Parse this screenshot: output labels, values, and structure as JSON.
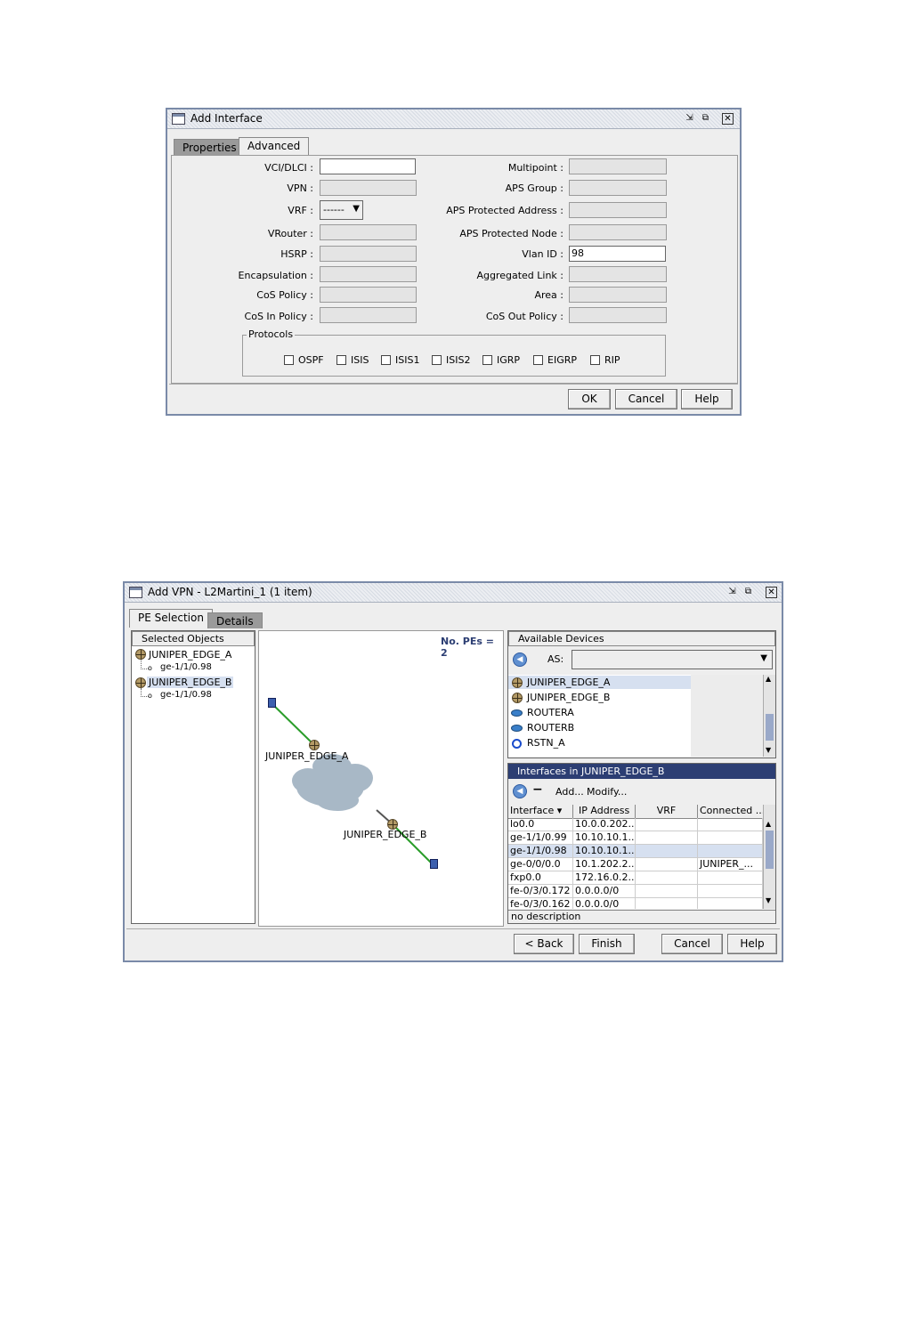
{
  "add_interface": {
    "title": "Add Interface",
    "tabs": [
      "Properties",
      "Advanced"
    ],
    "left_fields": [
      {
        "label": "VCI/DLCI :",
        "value": "",
        "editable": true
      },
      {
        "label": "VPN :",
        "value": ""
      },
      {
        "label": "VRF :",
        "value": "------",
        "dropdown": true
      },
      {
        "label": "VRouter :",
        "value": ""
      },
      {
        "label": "HSRP :",
        "value": ""
      },
      {
        "label": "Encapsulation :",
        "value": ""
      },
      {
        "label": "CoS Policy :",
        "value": ""
      },
      {
        "label": "CoS In Policy :",
        "value": ""
      }
    ],
    "right_fields": [
      {
        "label": "Multipoint :",
        "value": ""
      },
      {
        "label": "APS Group :",
        "value": ""
      },
      {
        "label": "APS Protected Address :",
        "value": ""
      },
      {
        "label": "APS Protected Node :",
        "value": ""
      },
      {
        "label": "Vlan ID :",
        "value": "98",
        "editable": true
      },
      {
        "label": "Aggregated Link :",
        "value": ""
      },
      {
        "label": "Area :",
        "value": ""
      },
      {
        "label": "CoS Out Policy :",
        "value": ""
      }
    ],
    "protocols_legend": "Protocols",
    "protocols": [
      "OSPF",
      "ISIS",
      "ISIS1",
      "ISIS2",
      "IGRP",
      "EIGRP",
      "RIP"
    ],
    "buttons": {
      "ok": "OK",
      "cancel": "Cancel",
      "help": "Help"
    }
  },
  "add_vpn": {
    "title": "Add VPN - L2Martini_1 (1 item)",
    "tabs": [
      "PE Selection",
      "Details"
    ],
    "selected_header": "Selected Objects",
    "tree": [
      {
        "label": "JUNIPER_EDGE_A",
        "child": "ge-1/1/0.98"
      },
      {
        "label": "JUNIPER_EDGE_B",
        "child": "ge-1/1/0.98"
      }
    ],
    "pe_count": "No. PEs = 2",
    "topology_labels": {
      "a": "JUNIPER_EDGE_A",
      "b": "JUNIPER_EDGE_B"
    },
    "available_header": "Available Devices",
    "as_label": "AS:",
    "devices": [
      {
        "name": "JUNIPER_EDGE_A",
        "icon": "juniper-router-icon"
      },
      {
        "name": "JUNIPER_EDGE_B",
        "icon": "juniper-router-icon"
      },
      {
        "name": "ROUTERA",
        "icon": "router-icon"
      },
      {
        "name": "ROUTERB",
        "icon": "router-icon"
      },
      {
        "name": "RSTN_A",
        "icon": "rstn-icon"
      }
    ],
    "interfaces_header": "Interfaces in JUNIPER_EDGE_B",
    "iface_actions": {
      "remove": "−",
      "add": "Add...",
      "modify": "Modify..."
    },
    "columns": [
      "Interface ▾",
      "IP Address",
      "VRF",
      "Connected ..."
    ],
    "rows": [
      [
        "lo0.0",
        "10.0.0.202...",
        "",
        ""
      ],
      [
        "ge-1/1/0.99",
        "10.10.10.1...",
        "",
        ""
      ],
      [
        "ge-1/1/0.98",
        "10.10.10.1...",
        "",
        ""
      ],
      [
        "ge-0/0/0.0",
        "10.1.202.2...",
        "",
        "JUNIPER_..."
      ],
      [
        "fxp0.0",
        "172.16.0.2...",
        "",
        ""
      ],
      [
        "fe-0/3/0.172",
        "0.0.0.0/0",
        "",
        ""
      ],
      [
        "fe-0/3/0.162",
        "0.0.0.0/0",
        "",
        ""
      ]
    ],
    "description": "no description",
    "buttons": {
      "back": "< Back",
      "finish": "Finish",
      "cancel": "Cancel",
      "help": "Help"
    }
  },
  "colors": {
    "link": "#2a9d2a",
    "cloud": "#a8b8c6",
    "highlight": "#d6e0f0",
    "header_dark": "#2c3e73"
  }
}
